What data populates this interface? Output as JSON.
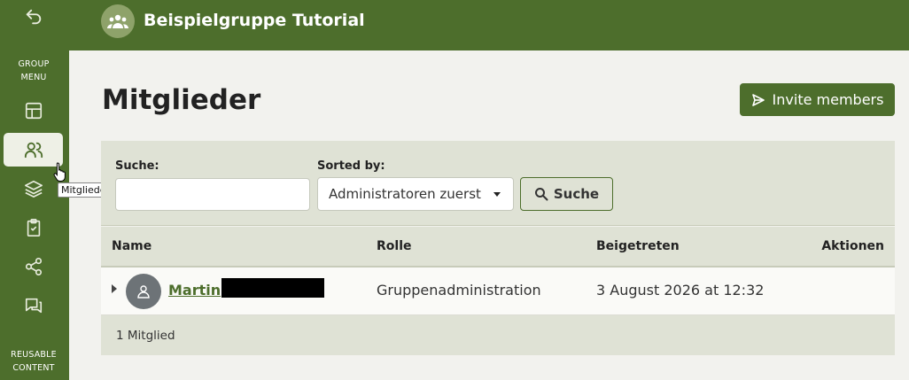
{
  "sidebar": {
    "group_menu_label": "GROUP\nMENU",
    "reusable_label": "REUSABLE\nCONTENT",
    "items": [
      {
        "icon": "back-arrow-icon"
      },
      {
        "icon": "dashboard-layout-icon"
      },
      {
        "icon": "members-icon",
        "active": true
      },
      {
        "icon": "layers-icon"
      },
      {
        "icon": "clipboard-check-icon"
      },
      {
        "icon": "share-icon"
      },
      {
        "icon": "chat-icon"
      }
    ],
    "tooltip": "Mitglieder"
  },
  "header": {
    "group_title": "Beispielgruppe Tutorial"
  },
  "page": {
    "title": "Mitglieder",
    "invite_label": "Invite members"
  },
  "filter": {
    "search_label": "Suche:",
    "search_value": "",
    "sort_label": "Sorted by:",
    "sort_value": "Administratoren zuerst",
    "search_button": "Suche"
  },
  "table": {
    "columns": [
      "Name",
      "Rolle",
      "Beigetreten",
      "Aktionen"
    ],
    "rows": [
      {
        "name": "Martin",
        "role": "Gruppenadministration",
        "joined": "3 August 2026 at 12:32"
      }
    ],
    "footer_count": "1 Mitglied"
  },
  "colors": {
    "primary": "#4d6e2c",
    "panel": "#dfe2d5",
    "background": "#f2f2ee"
  }
}
